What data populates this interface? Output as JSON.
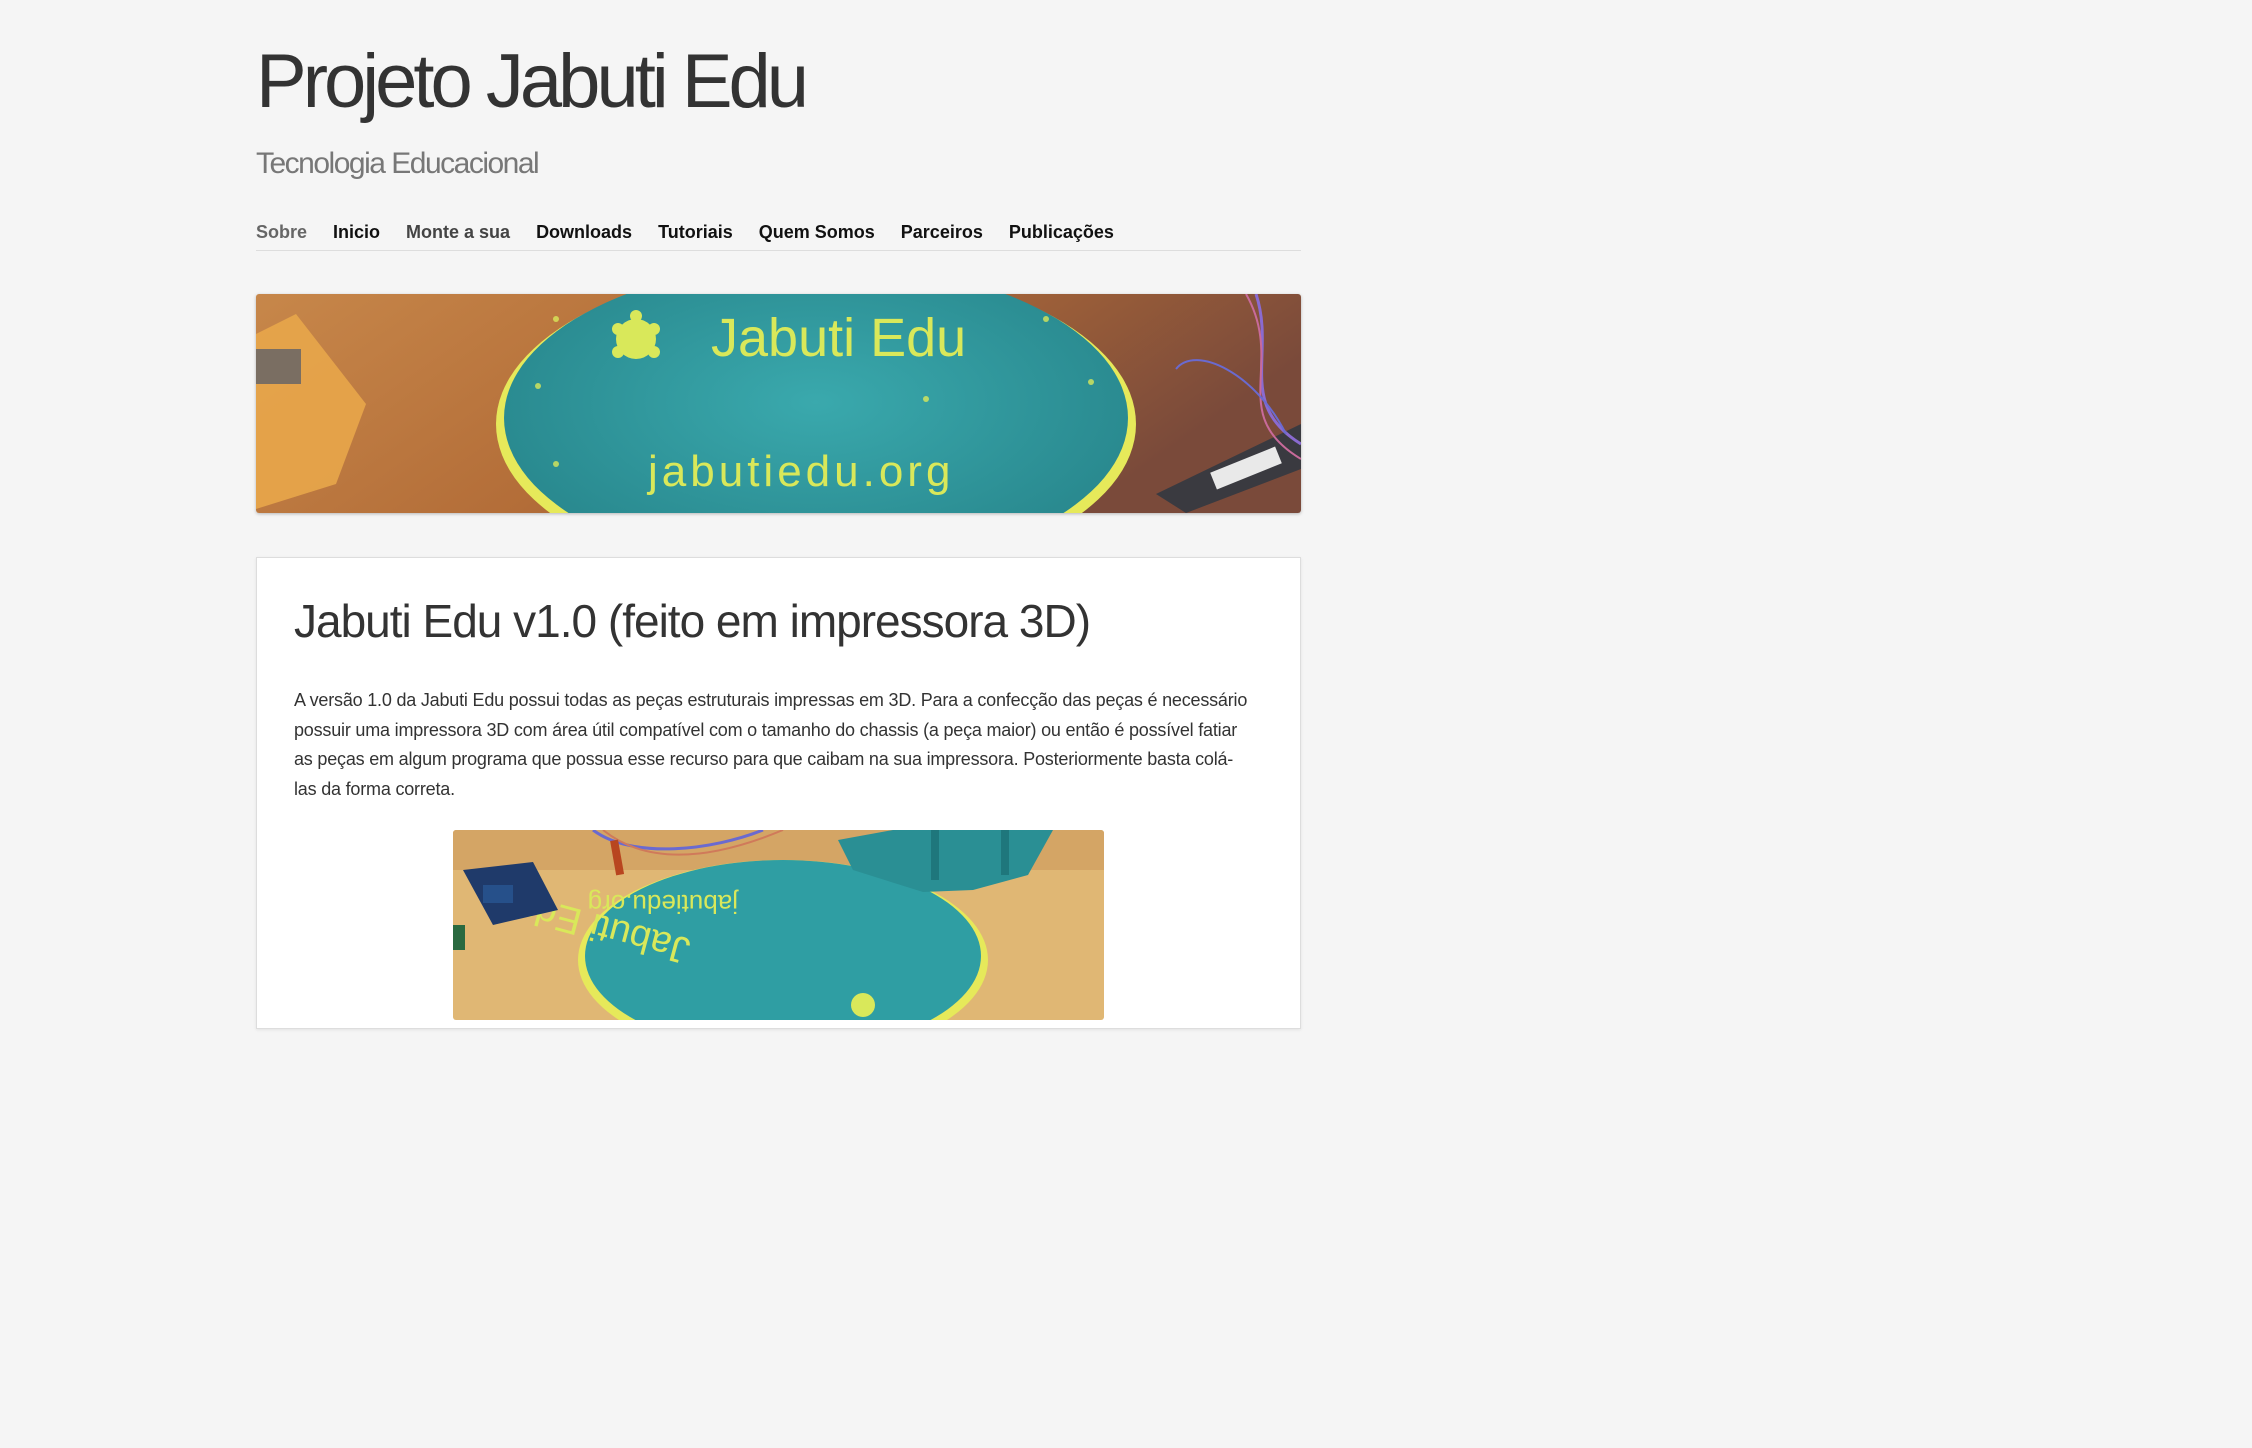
{
  "site": {
    "title": "Projeto Jabuti Edu",
    "tagline": "Tecnologia Educacional"
  },
  "nav": {
    "items": [
      {
        "label": "Sobre"
      },
      {
        "label": "Inicio"
      },
      {
        "label": "Monte a sua"
      },
      {
        "label": "Downloads"
      },
      {
        "label": "Tutoriais"
      },
      {
        "label": "Quem Somos"
      },
      {
        "label": "Parceiros"
      },
      {
        "label": "Publicações"
      }
    ]
  },
  "banner": {
    "disc_text_top": "Jabuti Edu",
    "disc_text_bottom": "jabutiedu.org"
  },
  "post": {
    "title": "Jabuti Edu v1.0 (feito em impressora 3D)",
    "body": "A versão 1.0 da Jabuti Edu possui todas as peças estruturais impressas em 3D. Para a confecção das peças é necessário possuir uma impressora 3D com área útil compatível com o tamanho do chassis (a peça maior) ou então é possível fatiar as peças em algum programa que possua esse recurso para que caibam na sua impressora. Posteriormente basta colá-las da forma correta.",
    "image": {
      "disc_text_top": "jabutiedu.org",
      "disc_text_bottom": "Jabuti Edu"
    }
  },
  "colors": {
    "background": "#f5f5f5",
    "disc_teal": "#2f9ea3",
    "disc_yellow": "#e8f06a",
    "wood": "#b9743e"
  }
}
